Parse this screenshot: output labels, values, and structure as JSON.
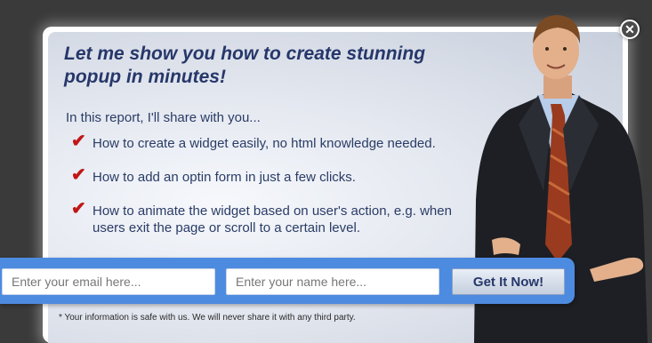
{
  "popup": {
    "headline": "Let me show you how to create stunning popup in minutes!",
    "intro": "In this report, I'll share with you...",
    "bullets": [
      {
        "text": "How to create a widget easily, no html knowledge needed."
      },
      {
        "text": "How to add an optin form in just a few clicks."
      },
      {
        "text": "How to animate the widget based on user's action, e.g. when users exit the page or scroll to a certain level."
      }
    ],
    "check_glyph": "✔",
    "disclaimer": "* Your information is safe with us. We will never share it with any third party.",
    "close_glyph": "✕"
  },
  "form": {
    "email_placeholder": "Enter your email here...",
    "name_placeholder": "Enter your name here...",
    "submit_label": "Get It Now!"
  },
  "colors": {
    "accent": "#4d8be0",
    "headline": "#26376a",
    "check": "#c01616"
  },
  "icons": {
    "check": "check-mark-icon",
    "close": "close-icon"
  }
}
